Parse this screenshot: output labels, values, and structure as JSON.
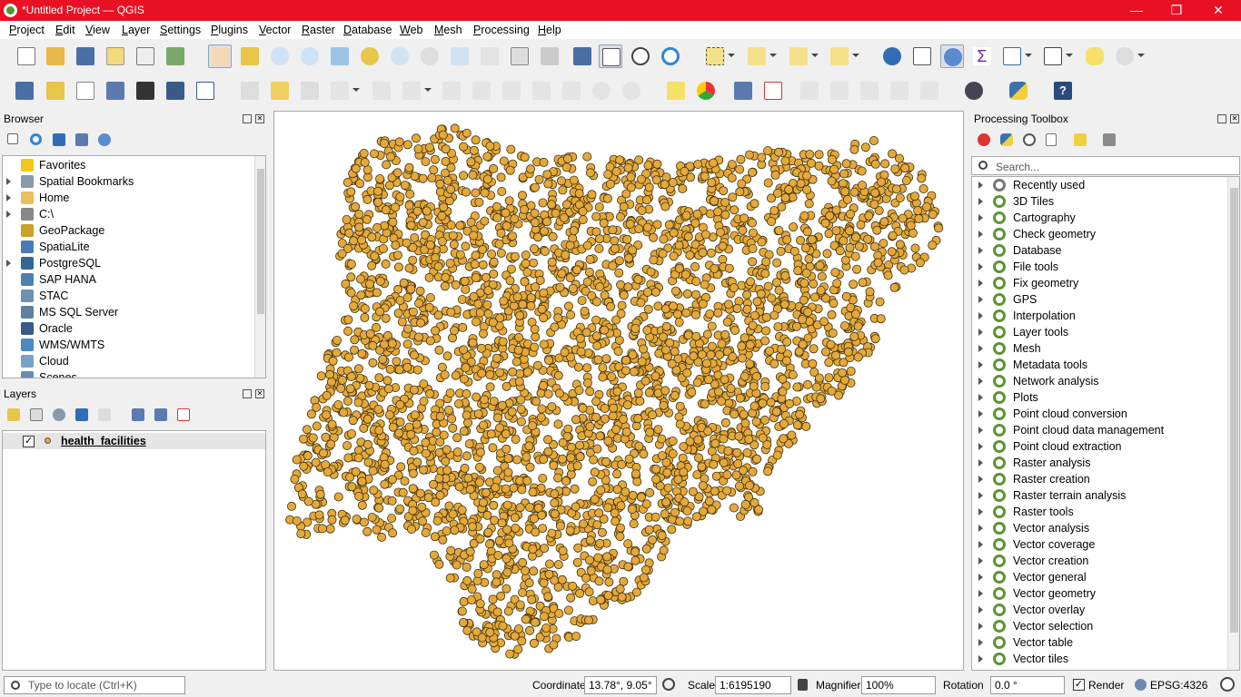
{
  "window": {
    "title": "*Untitled Project — QGIS",
    "controls": [
      "—",
      "❐",
      "✕"
    ]
  },
  "menu": [
    "Project",
    "Edit",
    "View",
    "Layer",
    "Settings",
    "Plugins",
    "Vector",
    "Raster",
    "Database",
    "Web",
    "Mesh",
    "Processing",
    "Help"
  ],
  "browser": {
    "title": "Browser",
    "items": [
      {
        "label": "Favorites",
        "icon": "star-icon",
        "expandable": false,
        "color": "#f5c518"
      },
      {
        "label": "Spatial Bookmarks",
        "icon": "bookmark-icon",
        "expandable": true,
        "color": "#8899aa"
      },
      {
        "label": "Home",
        "icon": "folder-icon",
        "expandable": true,
        "color": "#e8c060"
      },
      {
        "label": "C:\\",
        "icon": "drive-icon",
        "expandable": true,
        "color": "#888888"
      },
      {
        "label": "GeoPackage",
        "icon": "geopackage-icon",
        "expandable": false,
        "color": "#c9a227"
      },
      {
        "label": "SpatiaLite",
        "icon": "spatialite-icon",
        "expandable": false,
        "color": "#4a7ab5"
      },
      {
        "label": "PostgreSQL",
        "icon": "postgresql-icon",
        "expandable": true,
        "color": "#336791"
      },
      {
        "label": "SAP HANA",
        "icon": "sap-hana-icon",
        "expandable": false,
        "color": "#5080b0"
      },
      {
        "label": "STAC",
        "icon": "stac-icon",
        "expandable": false,
        "color": "#7090b0"
      },
      {
        "label": "MS SQL Server",
        "icon": "mssql-icon",
        "expandable": false,
        "color": "#6080a0"
      },
      {
        "label": "Oracle",
        "icon": "oracle-icon",
        "expandable": false,
        "color": "#3a5a8a"
      },
      {
        "label": "WMS/WMTS",
        "icon": "globe-icon",
        "expandable": false,
        "color": "#4a8ac0"
      },
      {
        "label": "Cloud",
        "icon": "cloud-icon",
        "expandable": false,
        "color": "#7aa0c8"
      },
      {
        "label": "Scenes",
        "icon": "scenes-icon",
        "expandable": false,
        "color": "#6a8ab0"
      }
    ]
  },
  "layers": {
    "title": "Layers",
    "items": [
      {
        "label": "health_facilities",
        "checked": true,
        "color": "#e5a93a"
      }
    ]
  },
  "toolbox": {
    "title": "Processing Toolbox",
    "search_placeholder": "Search...",
    "groups": [
      "Recently used",
      "3D Tiles",
      "Cartography",
      "Check geometry",
      "Database",
      "File tools",
      "Fix geometry",
      "GPS",
      "Interpolation",
      "Layer tools",
      "Mesh",
      "Metadata tools",
      "Network analysis",
      "Plots",
      "Point cloud conversion",
      "Point cloud data management",
      "Point cloud extraction",
      "Raster analysis",
      "Raster creation",
      "Raster terrain analysis",
      "Raster tools",
      "Vector analysis",
      "Vector coverage",
      "Vector creation",
      "Vector general",
      "Vector geometry",
      "Vector overlay",
      "Vector selection",
      "Vector table",
      "Vector tiles"
    ]
  },
  "status": {
    "locate_placeholder": "Type to locate (Ctrl+K)",
    "coordinate_label": "Coordinate",
    "coordinate_value": "13.78°, 9.05°",
    "scale_label": "Scale",
    "scale_value": "1:6195190",
    "magnifier_label": "Magnifier",
    "magnifier_value": "100%",
    "rotation_label": "Rotation",
    "rotation_value": "0.0 °",
    "render_label": "Render",
    "render_checked": true,
    "crs": "EPSG:4326"
  },
  "colors": {
    "titlebar": "#e81123",
    "point_fill": "#e5a93a",
    "point_stroke": "#3d2f10",
    "qgis_green": "#589632"
  }
}
